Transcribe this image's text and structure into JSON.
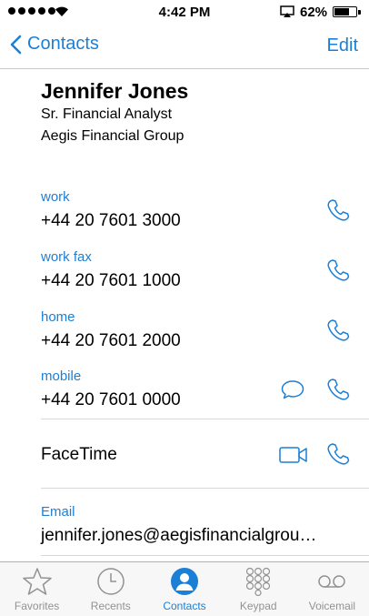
{
  "status": {
    "time": "4:42 PM",
    "battery": "62%"
  },
  "nav": {
    "back_label": "Contacts",
    "edit_label": "Edit"
  },
  "contact": {
    "name": "Jennifer Jones",
    "title": "Sr. Financial Analyst",
    "company": "Aegis Financial Group"
  },
  "phones": [
    {
      "label": "work",
      "number": "+44 20 7601 3000"
    },
    {
      "label": "work fax",
      "number": "+44 20 7601 1000"
    },
    {
      "label": "home",
      "number": "+44 20 7601 2000"
    },
    {
      "label": "mobile",
      "number": "+44 20 7601 0000"
    }
  ],
  "facetime": {
    "label": "FaceTime"
  },
  "email": {
    "label": "Email",
    "value": "jennifer.jones@aegisfinancialgrou…"
  },
  "tabs": [
    {
      "label": "Favorites",
      "icon": "star-icon",
      "active": false
    },
    {
      "label": "Recents",
      "icon": "clock-icon",
      "active": false
    },
    {
      "label": "Contacts",
      "icon": "person-icon",
      "active": true
    },
    {
      "label": "Keypad",
      "icon": "keypad-icon",
      "active": false
    },
    {
      "label": "Voicemail",
      "icon": "voicemail-icon",
      "active": false
    }
  ],
  "colors": {
    "accent": "#1c7fd6",
    "inactive_tab": "#929292"
  }
}
